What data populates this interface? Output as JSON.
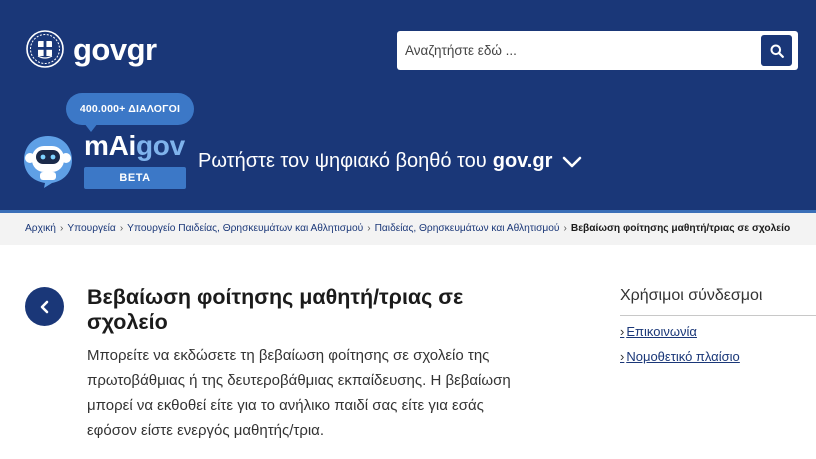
{
  "header": {
    "brand_gov": "gov",
    "brand_gr": "gr",
    "search": {
      "placeholder": "Αναζητήστε εδώ ..."
    }
  },
  "maigov": {
    "bubble": "400.000+ ΔΙΑΛΟΓΟΙ",
    "name_m": "mAi",
    "name_gov": "gov",
    "beta": "BETA",
    "ask_text": "Ρωτήστε τον ψηφιακό βοηθό του",
    "ask_brand": "gov.gr"
  },
  "breadcrumb": [
    "Αρχική",
    "Υπουργεία",
    "Υπουργείο Παιδείας, Θρησκευμάτων και Αθλητισμού",
    "Παιδείας, Θρησκευμάτων και Αθλητισμού"
  ],
  "breadcrumb_current": "Βεβαίωση φοίτησης μαθητή/τριας σε σχολείο",
  "main": {
    "title": "Βεβαίωση φοίτησης μαθητή/τριας σε σχολείο",
    "description": "Μπορείτε να εκδώσετε τη βεβαίωση φοίτησης σε σχολείο της πρωτοβάθμιας ή της δευτεροβάθμιας εκπαίδευσης. Η βεβαίωση μπορεί να εκθοθεί είτε για το ανήλικο παιδί σας είτε για εσάς εφόσον είστε ενεργός μαθητής/τρια."
  },
  "sidebar": {
    "title": "Χρήσιμοι σύνδεσμοι",
    "links": [
      "Επικοινωνία",
      "Νομοθετικό πλαίσιο"
    ]
  },
  "colors": {
    "primary": "#1a3778",
    "accent": "#3c78c7",
    "light_accent": "#7fb3ec"
  }
}
